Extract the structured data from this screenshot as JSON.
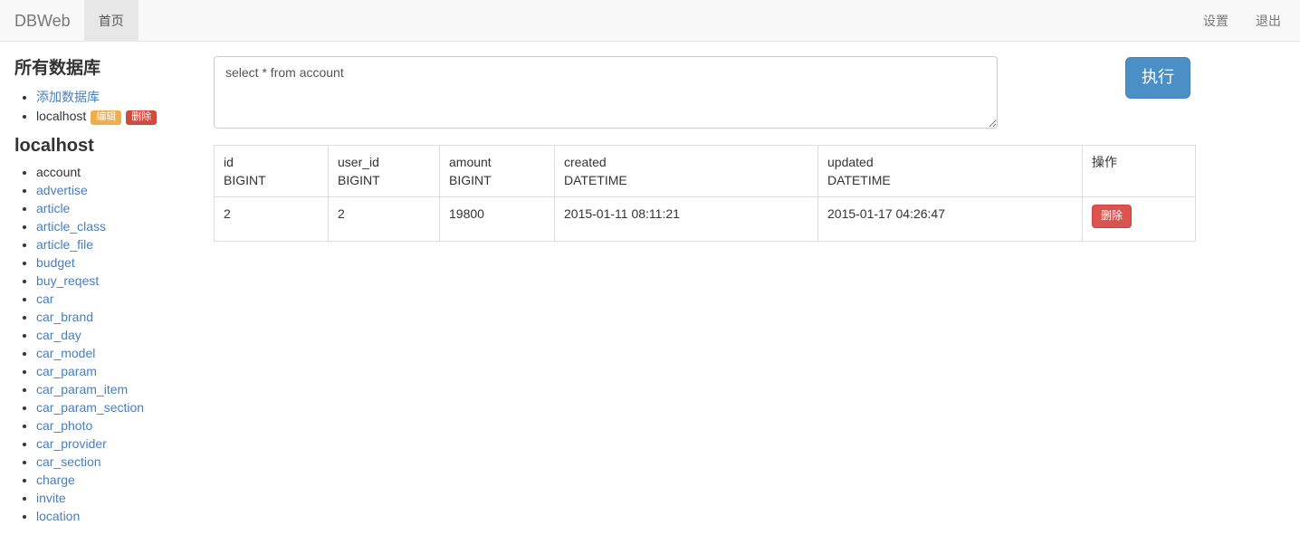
{
  "navbar": {
    "brand": "DBWeb",
    "items": [
      {
        "label": "首页",
        "active": true
      }
    ],
    "right_items": [
      {
        "label": "设置"
      },
      {
        "label": "退出"
      }
    ]
  },
  "sidebar": {
    "databases_heading": "所有数据库",
    "add_database_label": "添加数据库",
    "database": {
      "name": "localhost",
      "edit_label": "编辑",
      "delete_label": "删除"
    },
    "current_db_heading": "localhost",
    "tables": [
      {
        "name": "account",
        "selected": true
      },
      {
        "name": "advertise",
        "selected": false
      },
      {
        "name": "article",
        "selected": false
      },
      {
        "name": "article_class",
        "selected": false
      },
      {
        "name": "article_file",
        "selected": false
      },
      {
        "name": "budget",
        "selected": false
      },
      {
        "name": "buy_reqest",
        "selected": false
      },
      {
        "name": "car",
        "selected": false
      },
      {
        "name": "car_brand",
        "selected": false
      },
      {
        "name": "car_day",
        "selected": false
      },
      {
        "name": "car_model",
        "selected": false
      },
      {
        "name": "car_param",
        "selected": false
      },
      {
        "name": "car_param_item",
        "selected": false
      },
      {
        "name": "car_param_section",
        "selected": false
      },
      {
        "name": "car_photo",
        "selected": false
      },
      {
        "name": "car_provider",
        "selected": false
      },
      {
        "name": "car_section",
        "selected": false
      },
      {
        "name": "charge",
        "selected": false
      },
      {
        "name": "invite",
        "selected": false
      },
      {
        "name": "location",
        "selected": false
      }
    ]
  },
  "query": {
    "sql_value": "select * from account",
    "sql_placeholder": "",
    "run_label": "执行"
  },
  "result": {
    "columns": [
      {
        "name": "id",
        "type": "BIGINT"
      },
      {
        "name": "user_id",
        "type": "BIGINT"
      },
      {
        "name": "amount",
        "type": "BIGINT"
      },
      {
        "name": "created",
        "type": "DATETIME"
      },
      {
        "name": "updated",
        "type": "DATETIME"
      },
      {
        "name": "操作",
        "type": ""
      }
    ],
    "rows": [
      {
        "id": "2",
        "user_id": "2",
        "amount": "19800",
        "created": "2015-01-11 08:11:21",
        "updated": "2015-01-17 04:26:47",
        "action_label": "删除"
      }
    ]
  },
  "colors": {
    "primary": "#4a90c7",
    "danger": "#d9534f",
    "warning": "#efad4e",
    "link": "#4a7ebb",
    "navbar_bg": "#f8f8f8"
  }
}
